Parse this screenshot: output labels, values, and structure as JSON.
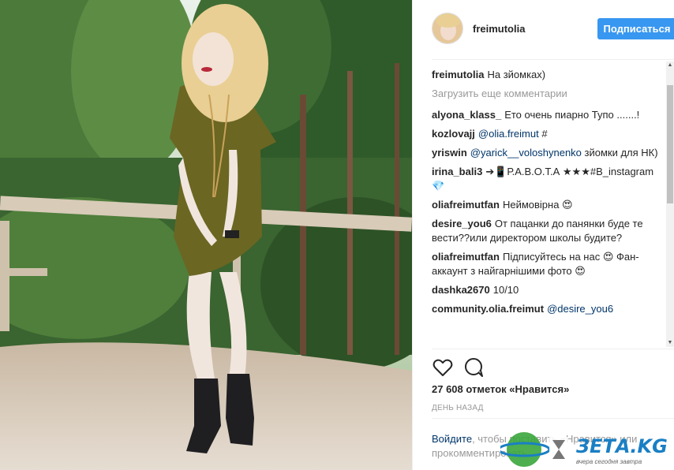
{
  "post": {
    "username": "freimutolia",
    "follow_label": "Подписаться",
    "caption_user": "freimutolia",
    "caption_text": "На зйомках)",
    "load_more": "Загрузить еще комментарии",
    "likes": "27 608 отметок «Нравится»",
    "time_ago": "ДЕНЬ НАЗАД"
  },
  "comments": [
    {
      "user": "alyona_klass_",
      "text": "Ето очень пиарно Тупо .......!"
    },
    {
      "user": "kozlovajj",
      "mention": "@olia.freimut",
      "text": " #"
    },
    {
      "user": "yriswin",
      "mention": "@yarick__voloshynenko",
      "text": " зйомки для НК)"
    },
    {
      "user": "irina_bali3",
      "text": "➔📱Р.А.В.О.Т.А ★★★#В_instagram💎"
    },
    {
      "user": "oliafreimutfan",
      "text": "Неймовірна 😍"
    },
    {
      "user": "desire_you6",
      "text": "От пацанки до панянки буде те вести??или директором школы будите?"
    },
    {
      "user": "oliafreimutfan",
      "text": "Підписуйтесь на нас 😍 Фан-аккаунт з найгарнішими фото 😍"
    },
    {
      "user": "dashka2670",
      "text": "10/10"
    },
    {
      "user": "community.olia.freimut",
      "mention": "@desire_you6",
      "text": ""
    }
  ],
  "login": {
    "link": "Войдите",
    "text": ", чтобы поставить «Нравится» или прокомментировать."
  },
  "watermark": {
    "brand": "ЗЕТА.KG",
    "tagline": "вчера сегодня завтра"
  },
  "icons": {
    "like": "heart-outline-icon",
    "comment": "speech-bubble-icon"
  },
  "colors": {
    "accent": "#3897f0",
    "mention": "#003569",
    "muted": "#999999"
  }
}
